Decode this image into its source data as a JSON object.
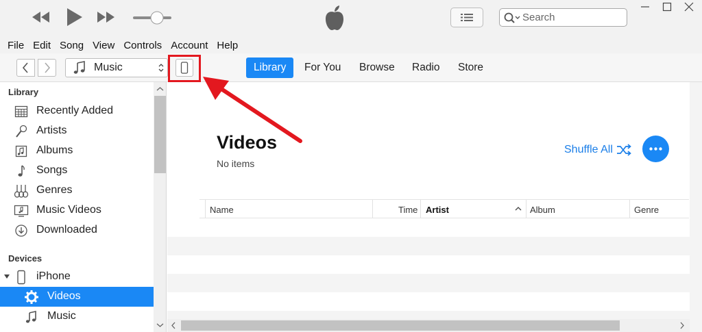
{
  "window": {
    "search_placeholder": "Search",
    "controls": [
      "minimize",
      "maximize",
      "close"
    ]
  },
  "player": {
    "icons": [
      "rewind-icon",
      "play-icon",
      "fast-forward-icon",
      "volume-slider"
    ],
    "volume_level": 0.6
  },
  "menu": [
    "File",
    "Edit",
    "Song",
    "View",
    "Controls",
    "Account",
    "Help"
  ],
  "navbar": {
    "media_selector": "Music",
    "tabs": [
      {
        "label": "Library",
        "active": true
      },
      {
        "label": "For You",
        "active": false
      },
      {
        "label": "Browse",
        "active": false
      },
      {
        "label": "Radio",
        "active": false
      },
      {
        "label": "Store",
        "active": false
      }
    ]
  },
  "sidebar": {
    "library_heading": "Library",
    "library_items": [
      {
        "label": "Recently Added",
        "icon": "grid-calendar-icon"
      },
      {
        "label": "Artists",
        "icon": "microphone-icon"
      },
      {
        "label": "Albums",
        "icon": "album-icon"
      },
      {
        "label": "Songs",
        "icon": "music-note-icon"
      },
      {
        "label": "Genres",
        "icon": "guitars-icon"
      },
      {
        "label": "Music Videos",
        "icon": "music-video-icon"
      },
      {
        "label": "Downloaded",
        "icon": "download-circle-icon"
      }
    ],
    "devices_heading": "Devices",
    "device": {
      "label": "iPhone",
      "icon": "iphone-icon"
    },
    "device_items": [
      {
        "label": "Videos",
        "icon": "gear-icon",
        "selected": true
      },
      {
        "label": "Music",
        "icon": "music-note-icon",
        "selected": false
      }
    ]
  },
  "content": {
    "title": "Videos",
    "subtitle": "No items",
    "shuffle_label": "Shuffle All",
    "columns": [
      "Name",
      "Time",
      "Artist",
      "Album",
      "Genre"
    ],
    "sorted_column": "Artist"
  },
  "colors": {
    "accent": "#1a88f5",
    "annotation": "#e3181f"
  }
}
